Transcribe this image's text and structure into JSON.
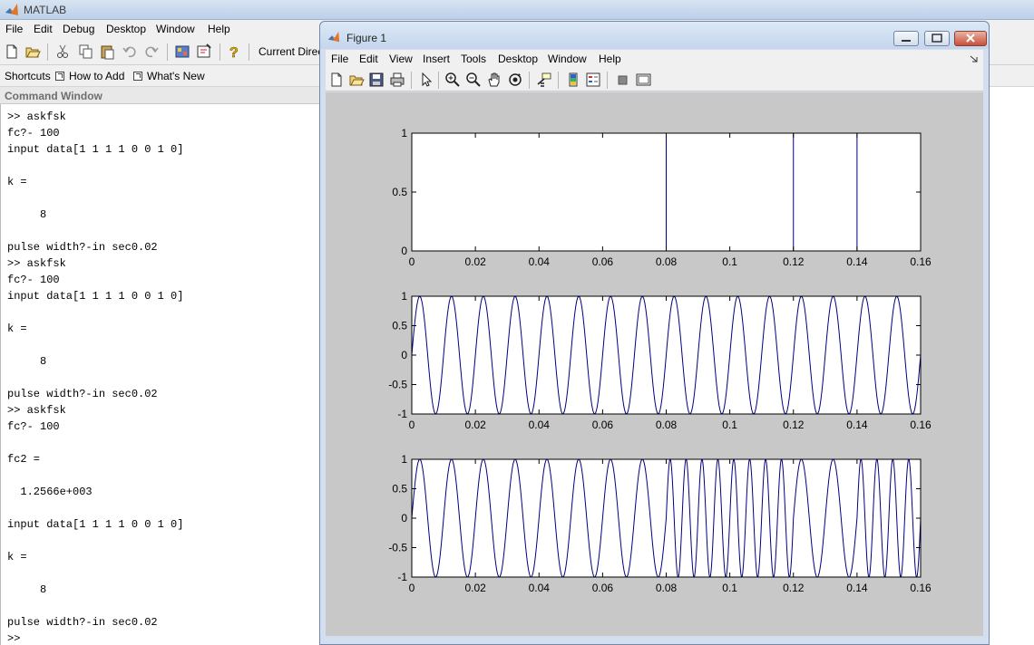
{
  "main_window": {
    "title": "MATLAB",
    "menu": [
      "File",
      "Edit",
      "Debug",
      "Desktop",
      "Window",
      "Help"
    ],
    "toolbar": {
      "icons": [
        "new-file-icon",
        "open-folder-icon",
        "cut-icon",
        "copy-icon",
        "paste-icon",
        "undo-icon",
        "redo-icon",
        "simulink-icon",
        "guide-icon",
        "help-icon"
      ],
      "current_dir_label": "Current Direct"
    },
    "shortcuts": {
      "label": "Shortcuts",
      "how_to_add": "How to Add",
      "whats_new": "What's New"
    }
  },
  "command_window": {
    "header": "Command Window",
    "lines": [
      ">> askfsk",
      "fc?- 100",
      "input data[1 1 1 1 0 0 1 0]",
      "",
      "k =",
      "",
      "     8",
      "",
      "pulse width?-in sec0.02",
      ">> askfsk",
      "fc?- 100",
      "input data[1 1 1 1 0 0 1 0]",
      "",
      "k =",
      "",
      "     8",
      "",
      "pulse width?-in sec0.02",
      ">> askfsk",
      "fc?- 100",
      "",
      "fc2 =",
      "",
      "  1.2566e+003",
      "",
      "input data[1 1 1 1 0 0 1 0]",
      "",
      "k =",
      "",
      "     8",
      "",
      "pulse width?-in sec0.02",
      ">>"
    ]
  },
  "figure_window": {
    "title": "Figure 1",
    "menu": [
      "File",
      "Edit",
      "View",
      "Insert",
      "Tools",
      "Desktop",
      "Window",
      "Help"
    ],
    "toolbar_icons": [
      "new-figure-icon",
      "open-file-icon",
      "save-icon",
      "print-icon",
      "pointer-icon",
      "zoom-in-icon",
      "zoom-out-icon",
      "pan-icon",
      "rotate-icon",
      "data-cursor-icon",
      "colorbar-icon",
      "legend-icon",
      "hide-plot-tools-icon",
      "show-plot-tools-icon"
    ]
  },
  "chart_data": [
    {
      "type": "line",
      "xlim": [
        0,
        0.16
      ],
      "ylim": [
        0,
        1
      ],
      "xticks": [
        "0",
        "0.02",
        "0.04",
        "0.06",
        "0.08",
        "0.1",
        "0.12",
        "0.14",
        "0.16"
      ],
      "yticks": [
        "0",
        "0.5",
        "1"
      ],
      "series": [
        {
          "color": "#000080",
          "x": [
            0,
            0.08,
            0.08,
            0.12,
            0.12,
            0.14,
            0.14,
            0.16
          ],
          "y": [
            1,
            1,
            0,
            0,
            1,
            1,
            0,
            0
          ]
        }
      ],
      "title": "",
      "xlabel": "",
      "ylabel": ""
    },
    {
      "type": "line",
      "xlim": [
        0,
        0.16
      ],
      "ylim": [
        -1,
        1
      ],
      "xticks": [
        "0",
        "0.02",
        "0.04",
        "0.06",
        "0.08",
        "0.1",
        "0.12",
        "0.14",
        "0.16"
      ],
      "yticks": [
        "-1",
        "-0.5",
        "0",
        "0.5",
        "1"
      ],
      "series": [
        {
          "color": "#000080",
          "function": "sin",
          "segments": [
            {
              "x0": 0,
              "x1": 0.16,
              "freq": 100
            }
          ]
        }
      ],
      "title": "",
      "xlabel": "",
      "ylabel": ""
    },
    {
      "type": "line",
      "xlim": [
        0,
        0.16
      ],
      "ylim": [
        -1,
        1
      ],
      "xticks": [
        "0",
        "0.02",
        "0.04",
        "0.06",
        "0.08",
        "0.1",
        "0.12",
        "0.14",
        "0.16"
      ],
      "yticks": [
        "-1",
        "-0.5",
        "0",
        "0.5",
        "1"
      ],
      "series": [
        {
          "color": "#000080",
          "function": "sin",
          "segments": [
            {
              "x0": 0,
              "x1": 0.08,
              "freq": 100
            },
            {
              "x0": 0.08,
              "x1": 0.12,
              "freq": 200
            },
            {
              "x0": 0.12,
              "x1": 0.14,
              "freq": 100
            },
            {
              "x0": 0.14,
              "x1": 0.16,
              "freq": 200
            }
          ]
        }
      ],
      "title": "",
      "xlabel": "",
      "ylabel": ""
    }
  ]
}
